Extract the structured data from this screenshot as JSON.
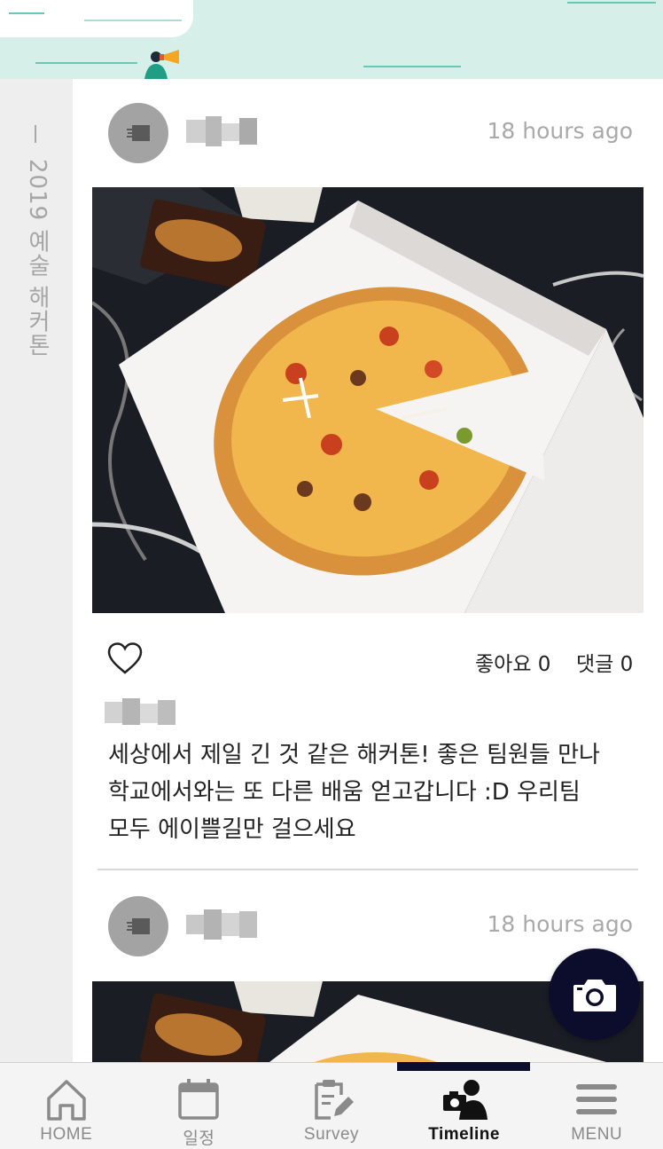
{
  "sidebar": {
    "title": "2019 예술 해커톤"
  },
  "posts": [
    {
      "timestamp": "18 hours ago",
      "likes_label": "좋아요 0",
      "comments_label": "댓글 0",
      "caption_lines": [
        "세상에서 제일 긴 것 같은 해커톤! 좋은 팀원들 만나",
        "학교에서와는 또 다른 배움 얻고갑니다 :D 우리팀",
        "모두 에이쁠길만 걸으세요"
      ]
    },
    {
      "timestamp": "18 hours ago"
    }
  ],
  "nav": {
    "items": [
      {
        "label": "HOME",
        "icon": "home-icon"
      },
      {
        "label": "일정",
        "icon": "calendar-icon"
      },
      {
        "label": "Survey",
        "icon": "clipboard-edit-icon"
      },
      {
        "label": "Timeline",
        "icon": "photographer-icon",
        "active": true
      },
      {
        "label": "MENU",
        "icon": "hamburger-menu-icon"
      }
    ]
  },
  "colors": {
    "banner": "#d6efe9",
    "accent_dark": "#0c0c2c",
    "side_rail": "#eeeeee",
    "avatar": "#a3a3a3"
  }
}
